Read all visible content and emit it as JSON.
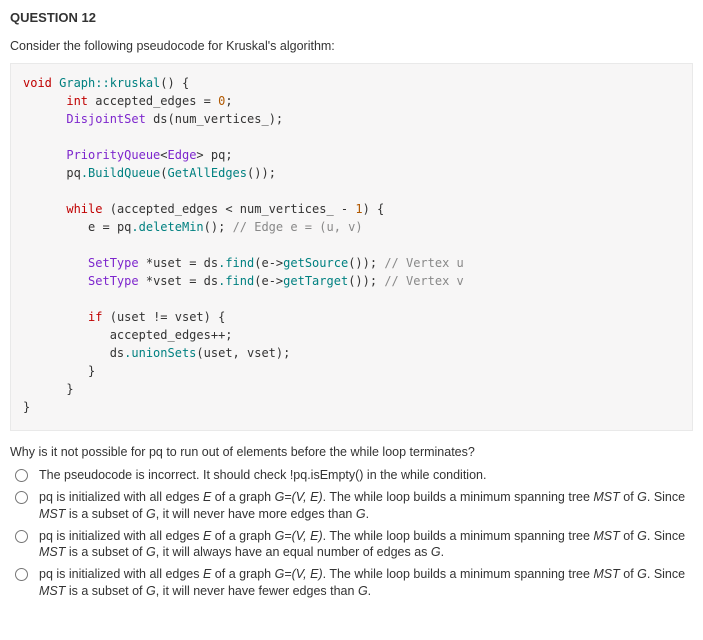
{
  "header": "QUESTION 12",
  "prompt": "Consider the following pseudocode for Kruskal's algorithm:",
  "code": {
    "l1a": "void",
    "l1b": " Graph::kruskal",
    "l1c": "() {",
    "l2a": "int",
    "l2b": " accepted_edges ",
    "l2c": "=",
    "l2d": " 0",
    "l2e": ";",
    "l3a": "DisjointSet",
    "l3b": " ds",
    "l3c": "(",
    "l3d": "num_vertices_",
    "l3e": ");",
    "l4a": "PriorityQueue",
    "l4b": "<",
    "l4c": "Edge",
    "l4d": ">",
    "l4e": " pq",
    "l4f": ";",
    "l5a": "pq",
    "l5b": ".BuildQueue",
    "l5c": "(",
    "l5d": "GetAllEdges",
    "l5e": "());",
    "l6a": "while",
    "l6b": " (",
    "l6c": "accepted_edges ",
    "l6d": "<",
    "l6e": " num_vertices_ ",
    "l6f": "-",
    "l6g": " 1",
    "l6h": ") {",
    "l7a": "e ",
    "l7b": "=",
    "l7c": " pq",
    "l7d": ".deleteMin",
    "l7e": "(); ",
    "l7f": "// Edge e = (u, v)",
    "l8a": "SetType ",
    "l8b": "*",
    "l8c": "uset ",
    "l8d": "=",
    "l8e": " ds",
    "l8f": ".find",
    "l8g": "(",
    "l8h": "e",
    "l8i": "->",
    "l8j": "getSource",
    "l8k": "()); ",
    "l8l": "// Vertex u",
    "l9a": "SetType ",
    "l9b": "*",
    "l9c": "vset ",
    "l9d": "=",
    "l9e": " ds",
    "l9f": ".find",
    "l9g": "(",
    "l9h": "e",
    "l9i": "->",
    "l9j": "getTarget",
    "l9k": "()); ",
    "l9l": "// Vertex v",
    "l10a": "if",
    "l10b": " (",
    "l10c": "uset ",
    "l10d": "!=",
    "l10e": " vset",
    "l10f": ") {",
    "l11a": "accepted_edges",
    "l11b": "++;",
    "l12a": "ds",
    "l12b": ".unionSets",
    "l12c": "(",
    "l12d": "uset",
    "l12e": ", ",
    "l12f": "vset",
    "l12g": ");",
    "l13a": "}",
    "l14a": "}",
    "l15a": "}"
  },
  "post_question": "Why is it not possible for pq to run out of elements before the while loop terminates?",
  "options": {
    "a": "The pseudocode is incorrect. It should check !pq.isEmpty() in the while condition.",
    "b_pre": "pq is initialized with all edges ",
    "b_E": "E",
    "b_mid1": " of a graph ",
    "b_G": "G=(V, E)",
    "b_mid2": ". The while loop builds a minimum spanning tree ",
    "b_MST1": "MST",
    "b_mid3": " of ",
    "b_Gv": "G",
    "b_mid4": ". Since ",
    "b_MST2": "MST",
    "b_mid5": " is a subset of ",
    "b_Gv2": "G",
    "b_end": ", it will never have more edges than ",
    "b_Gv3": "G",
    "b_dot": ".",
    "c_end": ", it will always have an equal number of edges as ",
    "d_end": ", it will never have fewer edges than "
  }
}
